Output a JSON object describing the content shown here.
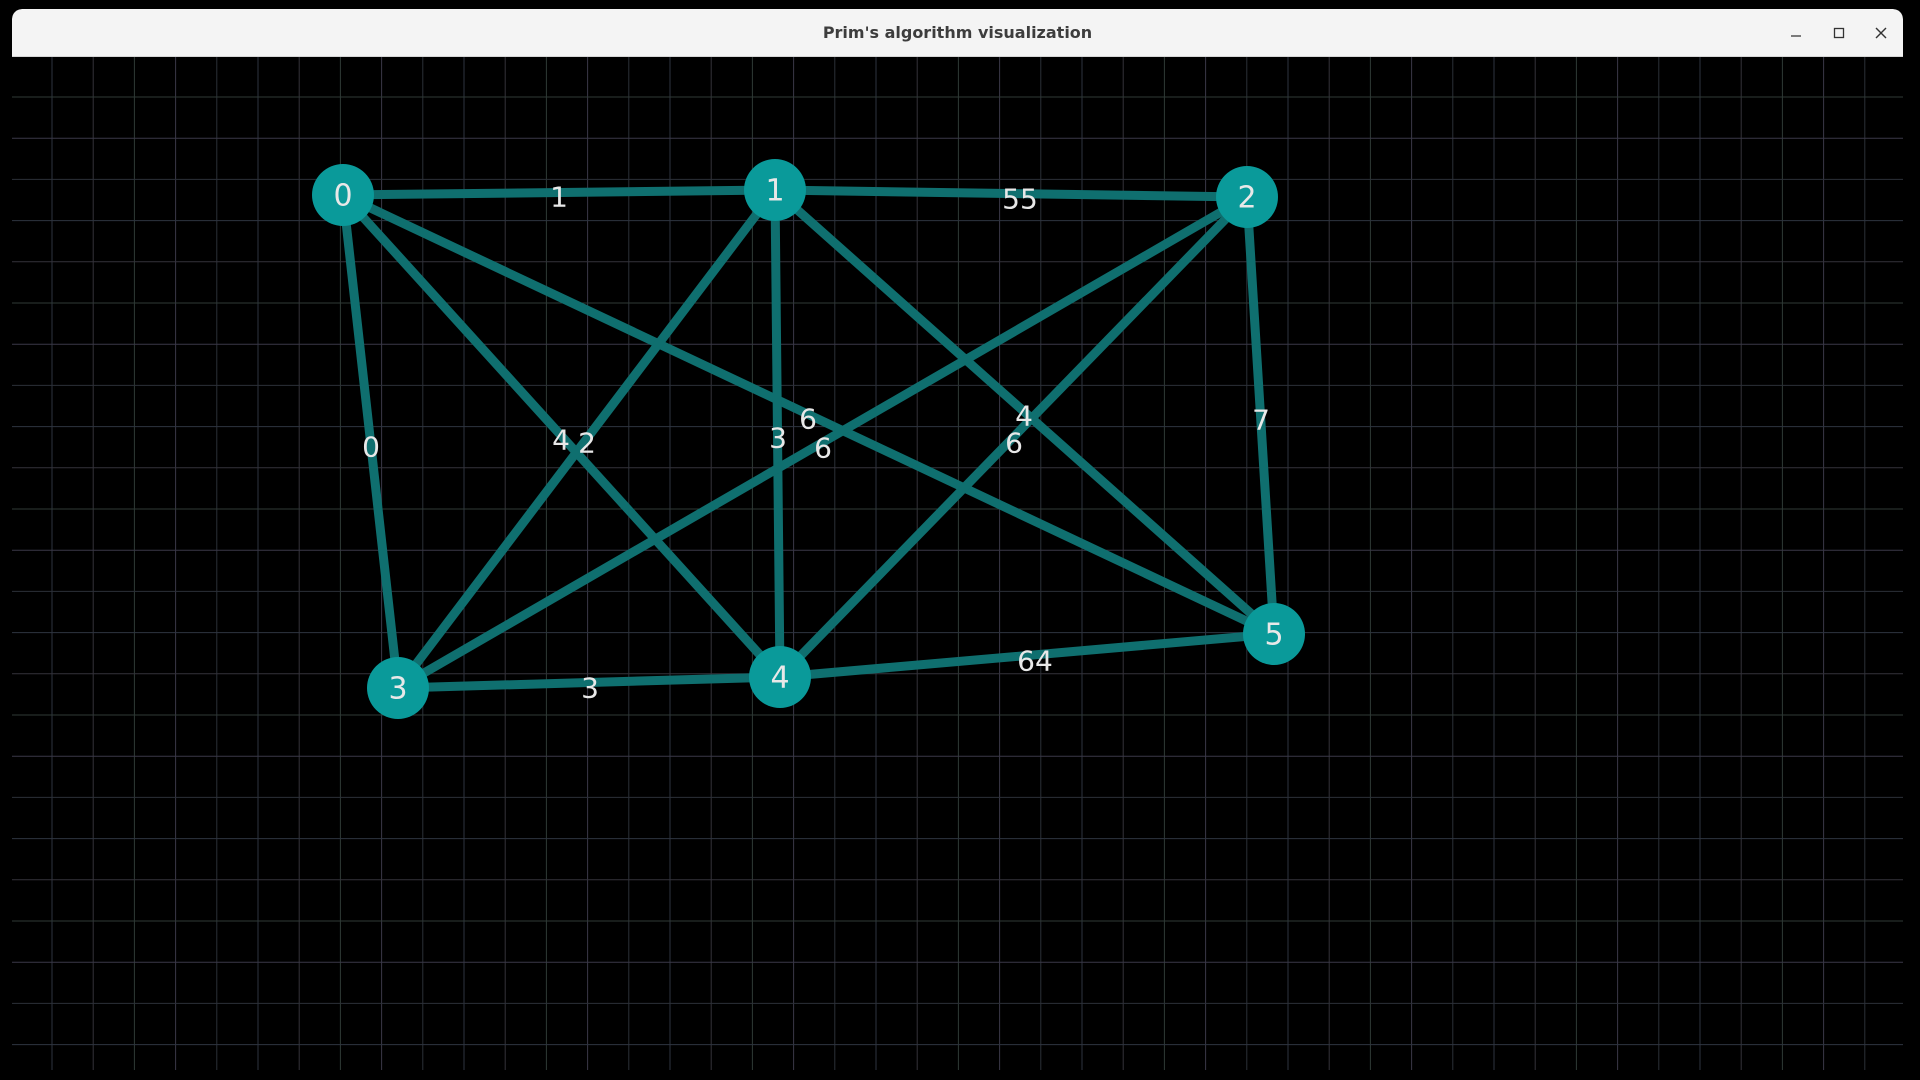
{
  "window": {
    "title": "Prim's algorithm visualization",
    "controls": {
      "minimize": "–",
      "maximize": "□",
      "close": "✕"
    }
  },
  "theme": {
    "edge_color": "#0f6f6f",
    "node_color": "#0a9a9a",
    "label_color": "#e8e8e8",
    "grid_color": "#3a3f4a",
    "background": "#000000"
  },
  "graph": {
    "nodes": [
      {
        "id": 0,
        "label": "0"
      },
      {
        "id": 1,
        "label": "1"
      },
      {
        "id": 2,
        "label": "2"
      },
      {
        "id": 3,
        "label": "3"
      },
      {
        "id": 4,
        "label": "4"
      },
      {
        "id": 5,
        "label": "5"
      }
    ],
    "edges": [
      {
        "from": 0,
        "to": 1,
        "weight": "1"
      },
      {
        "from": 1,
        "to": 2,
        "weight": "55"
      },
      {
        "from": 0,
        "to": 3,
        "weight": "0"
      },
      {
        "from": 0,
        "to": 4,
        "weight": "4"
      },
      {
        "from": 0,
        "to": 5,
        "weight": "6"
      },
      {
        "from": 1,
        "to": 3,
        "weight": "2"
      },
      {
        "from": 1,
        "to": 4,
        "weight": "3"
      },
      {
        "from": 1,
        "to": 5,
        "weight": "4"
      },
      {
        "from": 2,
        "to": 3,
        "weight": "6"
      },
      {
        "from": 2,
        "to": 4,
        "weight": "6"
      },
      {
        "from": 2,
        "to": 5,
        "weight": "7"
      },
      {
        "from": 3,
        "to": 4,
        "weight": "3"
      },
      {
        "from": 4,
        "to": 5,
        "weight": "64"
      }
    ]
  }
}
